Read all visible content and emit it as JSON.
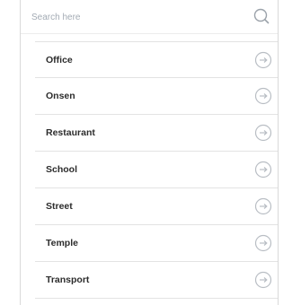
{
  "search": {
    "placeholder": "Search here",
    "icon": "search-icon"
  },
  "list": {
    "items": [
      {
        "label": "Office",
        "icon": "arrow-right-circle-icon"
      },
      {
        "label": "Onsen",
        "icon": "arrow-right-circle-icon"
      },
      {
        "label": "Restaurant",
        "icon": "arrow-right-circle-icon"
      },
      {
        "label": "School",
        "icon": "arrow-right-circle-icon"
      },
      {
        "label": "Street",
        "icon": "arrow-right-circle-icon"
      },
      {
        "label": "Temple",
        "icon": "arrow-right-circle-icon"
      },
      {
        "label": "Transport",
        "icon": "arrow-right-circle-icon"
      }
    ]
  },
  "colors": {
    "text": "#2c2c2c",
    "placeholder": "#a3abb4",
    "divider": "#e3e3e3",
    "icon": "#b9bec4"
  }
}
